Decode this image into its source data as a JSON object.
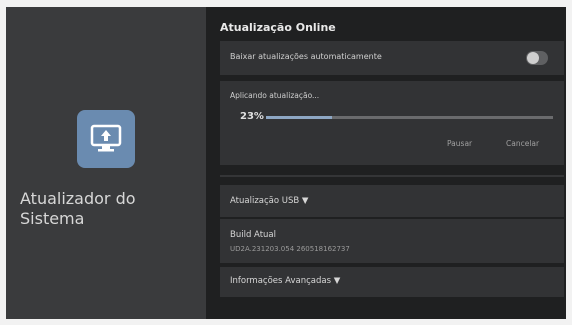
{
  "left_panel": {
    "app_title": "Atualizador do Sistema",
    "icon": "monitor-upload-icon",
    "icon_color": "#6a8bb0"
  },
  "online": {
    "section_title": "Atualização Online",
    "auto_download_label": "Baixar atualizações automaticamente",
    "auto_download_enabled": false,
    "progress_status": "Aplicando atualização...",
    "progress_percent_text": "23%",
    "progress_value": 0.23,
    "pause_label": "Pausar",
    "cancel_label": "Cancelar"
  },
  "usb": {
    "label": "Atualização USB ▼"
  },
  "build": {
    "label": "Build Atual",
    "value": "UD2A.231203.054 260518162737"
  },
  "advanced": {
    "label": "Informações Avançadas ▼"
  }
}
